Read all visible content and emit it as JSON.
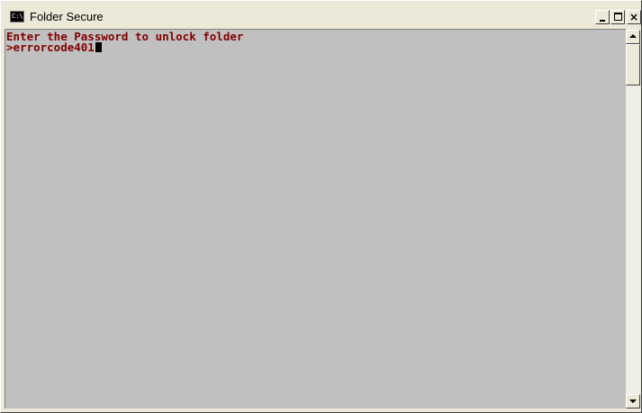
{
  "window": {
    "title": "Folder Secure",
    "icon": "console-icon",
    "icon_text": "C:\\"
  },
  "title_buttons": {
    "minimize": "minimize-icon",
    "maximize": "maximize-icon",
    "close": "×"
  },
  "console": {
    "prompt_message": "Enter the Password to unlock folder",
    "input_line": ">errorcode401",
    "text_color": "#800000",
    "background_color": "#c0c0c0"
  },
  "scrollbar": {
    "up_icon": "arrow-up-icon",
    "down_icon": "arrow-down-icon"
  }
}
